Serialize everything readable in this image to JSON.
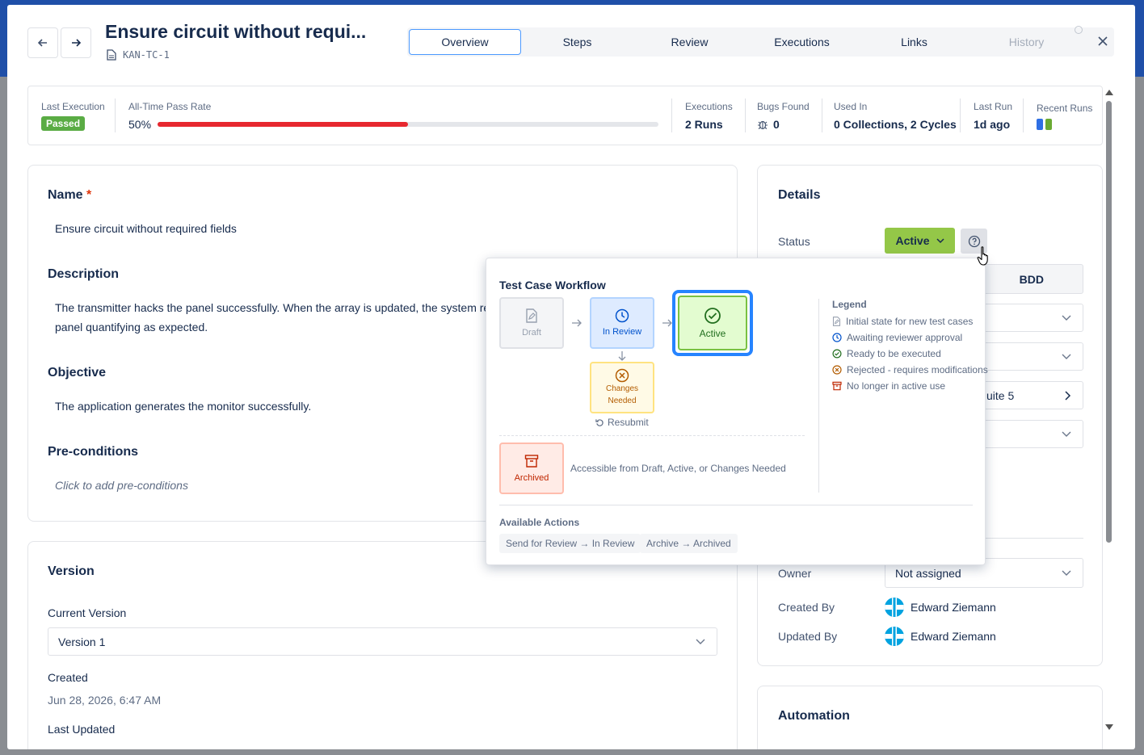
{
  "header": {
    "title": "Ensure circuit without requi...",
    "key": "KAN-TC-1",
    "tabs": [
      "Overview",
      "Steps",
      "Review",
      "Executions",
      "Links",
      "History"
    ]
  },
  "stats": {
    "last_execution_label": "Last Execution",
    "last_execution_value": "Passed",
    "pass_rate_label": "All-Time Pass Rate",
    "pass_rate_value": "50%",
    "pass_rate_fraction": 0.5,
    "executions_label": "Executions",
    "executions_value": "2 Runs",
    "bugs_label": "Bugs Found",
    "bugs_value": "0",
    "used_in_label": "Used In",
    "used_in_value": "0 Collections, 2 Cycles",
    "last_run_label": "Last Run",
    "last_run_value": "1d ago",
    "recent_runs_label": "Recent Runs",
    "recent_runs_colors": [
      "#2f6fe4",
      "#6aaa33"
    ]
  },
  "main": {
    "name_label": "Name",
    "name_required": "*",
    "name_value": "Ensure circuit without required fields",
    "description_label": "Description",
    "description_line1": "The transmitter hacks the panel successfully. When the array is updated, the system res",
    "description_line2": "panel quantifying as expected.",
    "objective_label": "Objective",
    "objective_value": "The application generates the monitor successfully.",
    "preconditions_label": "Pre-conditions",
    "preconditions_placeholder": "Click to add pre-conditions"
  },
  "version": {
    "heading": "Version",
    "current_label": "Current Version",
    "current_value": "Version 1",
    "created_label": "Created",
    "created_value": "Jun 28, 2026, 6:47 AM",
    "last_updated_label": "Last Updated"
  },
  "details": {
    "heading": "Details",
    "status_label": "Status",
    "status_value": "Active",
    "bdd_label": "BDD",
    "suite_partial": "uite 5",
    "owner_label": "Owner",
    "owner_value": "Not assigned",
    "created_by_label": "Created By",
    "created_by_value": "Edward Ziemann",
    "updated_by_label": "Updated By",
    "updated_by_value": "Edward Ziemann"
  },
  "automation": {
    "heading": "Automation"
  },
  "workflow": {
    "title": "Test Case Workflow",
    "nodes": {
      "draft": "Draft",
      "in_review": "In Review",
      "active": "Active",
      "changes_needed_1": "Changes",
      "changes_needed_2": "Needed",
      "archived": "Archived"
    },
    "resubmit": "Resubmit",
    "archived_note": "Accessible from Draft, Active, or Changes Needed",
    "legend_title": "Legend",
    "legend": [
      "Initial state for new test cases",
      "Awaiting reviewer approval",
      "Ready to be executed",
      "Rejected - requires modifications",
      "No longer in active use"
    ],
    "actions_title": "Available Actions",
    "actions": [
      "Send for Review → In Review",
      "Archive → Archived"
    ]
  }
}
